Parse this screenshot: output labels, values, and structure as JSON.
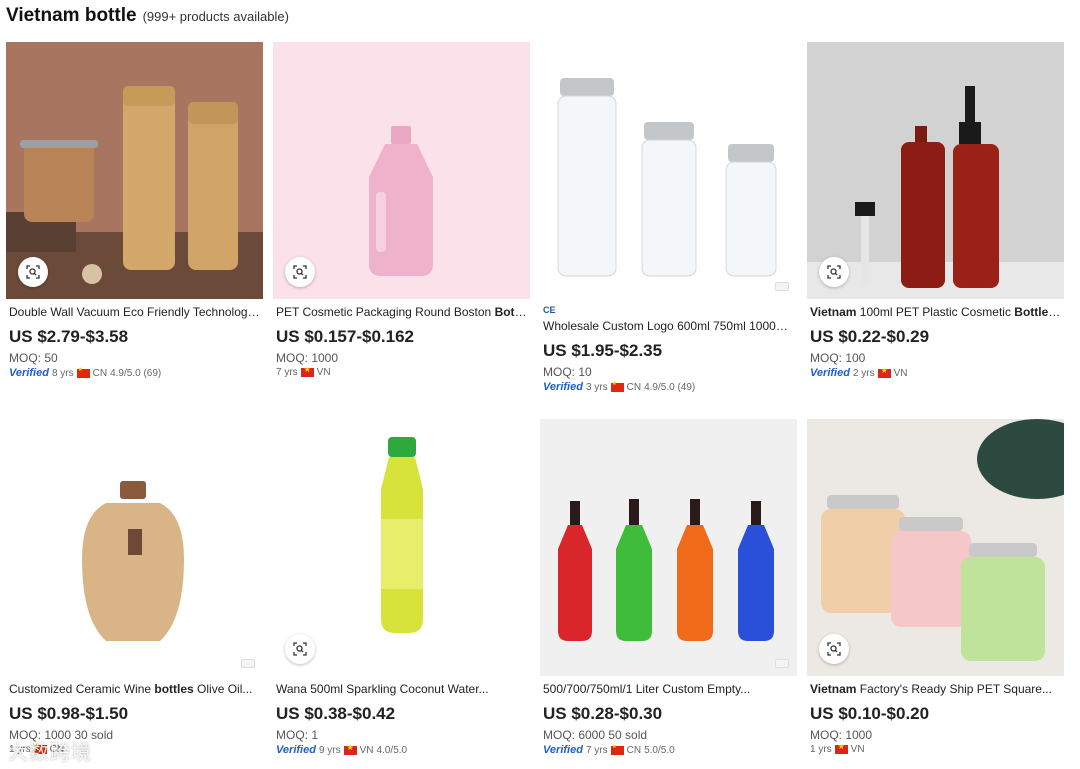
{
  "header": {
    "title": "Vietnam bottle",
    "count": "(999+ products available)"
  },
  "products": [
    {
      "name_parts": [
        "Double Wall Vacuum Eco Friendly Technology..."
      ],
      "price": "US $2.79-$3.58",
      "moq": "MOQ: 50",
      "verified": "Verified",
      "years": "8 yrs",
      "country": "CN",
      "flag": "cn",
      "rating": "4.9/5.0 (69)",
      "ce": "",
      "colors": {
        "bg": "#a0705a"
      }
    },
    {
      "name_parts": [
        "PET Cosmetic Packaging Round Boston ",
        "Bottl..."
      ],
      "price": "US $0.157-$0.162",
      "moq": "MOQ: 1000",
      "verified": "",
      "years": "7 yrs",
      "country": "VN",
      "flag": "vn",
      "rating": "",
      "ce": "",
      "colors": {
        "bg": "#fbe1ea"
      }
    },
    {
      "name_parts": [
        "Wholesale Custom Logo 600ml 750ml 1000ml..."
      ],
      "price": "US $1.95-$2.35",
      "moq": "MOQ: 10",
      "verified": "Verified",
      "years": "3 yrs",
      "country": "CN",
      "flag": "cn",
      "rating": "4.9/5.0 (49)",
      "ce": "CE",
      "colors": {
        "bg": "#ffffff"
      }
    },
    {
      "name_parts": [
        "Vietnam",
        " 100ml PET Plastic Cosmetic ",
        "Bottles..."
      ],
      "price": "US $0.22-$0.29",
      "moq": "MOQ: 100",
      "verified": "Verified",
      "years": "2 yrs",
      "country": "VN",
      "flag": "vn",
      "rating": "",
      "ce": "",
      "colors": {
        "bg": "#cfcfcf"
      }
    },
    {
      "name_parts": [
        "Customized Ceramic Wine ",
        "bottles",
        " Olive Oil..."
      ],
      "price": "US $0.98-$1.50",
      "moq": "MOQ: 1000 30 sold",
      "verified": "",
      "years": "1 yrs",
      "country": "CN",
      "flag": "cn",
      "rating": "",
      "ce": "",
      "colors": {
        "bg": "#ffffff"
      }
    },
    {
      "name_parts": [
        "Wana 500ml Sparkling Coconut Water..."
      ],
      "price": "US $0.38-$0.42",
      "moq": "MOQ: 1",
      "verified": "Verified",
      "years": "9 yrs",
      "country": "VN",
      "flag": "vn",
      "rating": "4.0/5.0",
      "ce": "",
      "colors": {
        "bg": "#ffffff"
      }
    },
    {
      "name_parts": [
        "500/700/750ml/1 Liter Custom Empty..."
      ],
      "price": "US $0.28-$0.30",
      "moq": "MOQ: 6000 50 sold",
      "verified": "Verified",
      "years": "7 yrs",
      "country": "CN",
      "flag": "cn",
      "rating": "5.0/5.0",
      "ce": "",
      "colors": {
        "bg": "#f2f2f2"
      }
    },
    {
      "name_parts": [
        "Vietnam",
        " Factory's Ready Ship PET Square..."
      ],
      "price": "US $0.10-$0.20",
      "moq": "MOQ: 1000",
      "verified": "",
      "years": "1 yrs",
      "country": "VN",
      "flag": "vn",
      "rating": "",
      "ce": "",
      "colors": {
        "bg": "#e9e6e2"
      }
    }
  ],
  "watermark": "大数跨境",
  "icons": {
    "image_search": "image-search-icon"
  }
}
